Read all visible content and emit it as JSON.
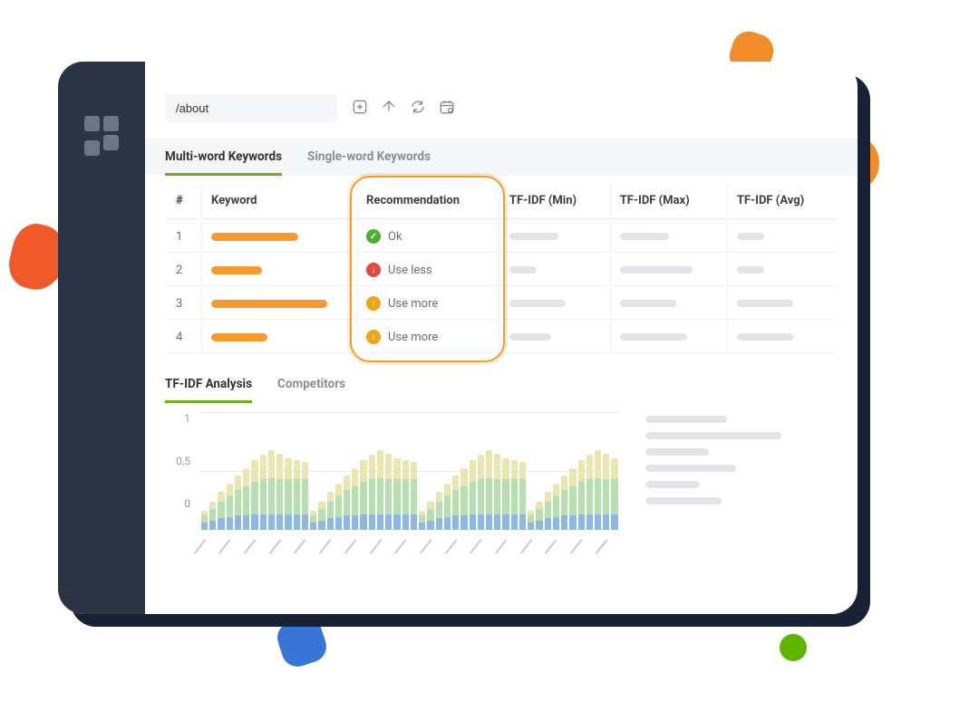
{
  "url_value": "/about",
  "toolbar_icons": [
    "add-icon",
    "share-icon",
    "refresh-icon",
    "schedule-icon"
  ],
  "tabs": {
    "items": [
      {
        "label": "Multi-word Keywords",
        "active": true
      },
      {
        "label": "Single-word Keywords",
        "active": false
      }
    ]
  },
  "table": {
    "headers": {
      "idx": "#",
      "keyword": "Keyword",
      "recommendation": "Recommendation",
      "min": "TF-IDF (Min)",
      "max": "TF-IDF (Max)",
      "avg": "TF-IDF (Avg)"
    },
    "rows": [
      {
        "idx": "1",
        "kw_width": 96,
        "rec": "Ok",
        "rec_kind": "ok",
        "min_w": 54,
        "max_w": 54,
        "avg_w": 30
      },
      {
        "idx": "2",
        "kw_width": 56,
        "rec": "Use less",
        "rec_kind": "less",
        "min_w": 30,
        "max_w": 80,
        "avg_w": 30
      },
      {
        "idx": "3",
        "kw_width": 128,
        "rec": "Use more",
        "rec_kind": "more",
        "min_w": 62,
        "max_w": 62,
        "avg_w": 62
      },
      {
        "idx": "4",
        "kw_width": 62,
        "rec": "Use more",
        "rec_kind": "more",
        "min_w": 46,
        "max_w": 74,
        "avg_w": 62
      }
    ]
  },
  "analysis_tabs": {
    "items": [
      {
        "label": "TF-IDF Analysis",
        "active": true
      },
      {
        "label": "Competitors",
        "active": false
      }
    ]
  },
  "chart_data": {
    "type": "bar",
    "title": "TF-IDF Analysis",
    "xlabel": "",
    "ylabel": "",
    "ylim": [
      0,
      1
    ],
    "yticks": [
      "1",
      "0,5",
      "0"
    ],
    "stack_order": [
      "blue",
      "green",
      "yellow"
    ],
    "colors": {
      "blue": "#8FB7E6",
      "green": "#B7E0B0",
      "yellow": "#E9E6B0"
    },
    "notes": "x-axis labels rendered as diagonal tick marks without readable text in source image",
    "series": [
      {
        "name": "cycle",
        "len": 50,
        "pattern_period": 13,
        "blue": [
          0.06,
          0.08,
          0.1,
          0.11,
          0.12,
          0.12,
          0.13,
          0.13,
          0.13,
          0.13,
          0.13,
          0.13,
          0.13
        ],
        "green": [
          0.06,
          0.1,
          0.14,
          0.18,
          0.22,
          0.25,
          0.28,
          0.3,
          0.31,
          0.3,
          0.3,
          0.3,
          0.3
        ],
        "yellow": [
          0.04,
          0.06,
          0.08,
          0.1,
          0.12,
          0.15,
          0.18,
          0.21,
          0.24,
          0.22,
          0.18,
          0.16,
          0.15
        ]
      }
    ]
  },
  "legend_placeholder_widths": [
    90,
    150,
    70,
    100,
    60,
    84
  ]
}
